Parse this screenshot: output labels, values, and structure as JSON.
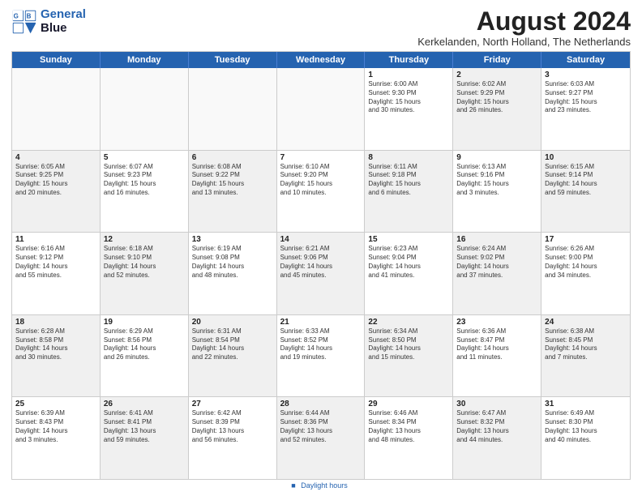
{
  "logo": {
    "line1": "General",
    "line2": "Blue"
  },
  "title": "August 2024",
  "location": "Kerkelanden, North Holland, The Netherlands",
  "days_of_week": [
    "Sunday",
    "Monday",
    "Tuesday",
    "Wednesday",
    "Thursday",
    "Friday",
    "Saturday"
  ],
  "footer": "Daylight hours",
  "weeks": [
    [
      {
        "day": "",
        "text": "",
        "empty": true
      },
      {
        "day": "",
        "text": "",
        "empty": true
      },
      {
        "day": "",
        "text": "",
        "empty": true
      },
      {
        "day": "",
        "text": "",
        "empty": true
      },
      {
        "day": "1",
        "text": "Sunrise: 6:00 AM\nSunset: 9:30 PM\nDaylight: 15 hours\nand 30 minutes.",
        "shaded": false
      },
      {
        "day": "2",
        "text": "Sunrise: 6:02 AM\nSunset: 9:29 PM\nDaylight: 15 hours\nand 26 minutes.",
        "shaded": true
      },
      {
        "day": "3",
        "text": "Sunrise: 6:03 AM\nSunset: 9:27 PM\nDaylight: 15 hours\nand 23 minutes.",
        "shaded": false
      }
    ],
    [
      {
        "day": "4",
        "text": "Sunrise: 6:05 AM\nSunset: 9:25 PM\nDaylight: 15 hours\nand 20 minutes.",
        "shaded": true
      },
      {
        "day": "5",
        "text": "Sunrise: 6:07 AM\nSunset: 9:23 PM\nDaylight: 15 hours\nand 16 minutes.",
        "shaded": false
      },
      {
        "day": "6",
        "text": "Sunrise: 6:08 AM\nSunset: 9:22 PM\nDaylight: 15 hours\nand 13 minutes.",
        "shaded": true
      },
      {
        "day": "7",
        "text": "Sunrise: 6:10 AM\nSunset: 9:20 PM\nDaylight: 15 hours\nand 10 minutes.",
        "shaded": false
      },
      {
        "day": "8",
        "text": "Sunrise: 6:11 AM\nSunset: 9:18 PM\nDaylight: 15 hours\nand 6 minutes.",
        "shaded": true
      },
      {
        "day": "9",
        "text": "Sunrise: 6:13 AM\nSunset: 9:16 PM\nDaylight: 15 hours\nand 3 minutes.",
        "shaded": false
      },
      {
        "day": "10",
        "text": "Sunrise: 6:15 AM\nSunset: 9:14 PM\nDaylight: 14 hours\nand 59 minutes.",
        "shaded": true
      }
    ],
    [
      {
        "day": "11",
        "text": "Sunrise: 6:16 AM\nSunset: 9:12 PM\nDaylight: 14 hours\nand 55 minutes.",
        "shaded": false
      },
      {
        "day": "12",
        "text": "Sunrise: 6:18 AM\nSunset: 9:10 PM\nDaylight: 14 hours\nand 52 minutes.",
        "shaded": true
      },
      {
        "day": "13",
        "text": "Sunrise: 6:19 AM\nSunset: 9:08 PM\nDaylight: 14 hours\nand 48 minutes.",
        "shaded": false
      },
      {
        "day": "14",
        "text": "Sunrise: 6:21 AM\nSunset: 9:06 PM\nDaylight: 14 hours\nand 45 minutes.",
        "shaded": true
      },
      {
        "day": "15",
        "text": "Sunrise: 6:23 AM\nSunset: 9:04 PM\nDaylight: 14 hours\nand 41 minutes.",
        "shaded": false
      },
      {
        "day": "16",
        "text": "Sunrise: 6:24 AM\nSunset: 9:02 PM\nDaylight: 14 hours\nand 37 minutes.",
        "shaded": true
      },
      {
        "day": "17",
        "text": "Sunrise: 6:26 AM\nSunset: 9:00 PM\nDaylight: 14 hours\nand 34 minutes.",
        "shaded": false
      }
    ],
    [
      {
        "day": "18",
        "text": "Sunrise: 6:28 AM\nSunset: 8:58 PM\nDaylight: 14 hours\nand 30 minutes.",
        "shaded": true
      },
      {
        "day": "19",
        "text": "Sunrise: 6:29 AM\nSunset: 8:56 PM\nDaylight: 14 hours\nand 26 minutes.",
        "shaded": false
      },
      {
        "day": "20",
        "text": "Sunrise: 6:31 AM\nSunset: 8:54 PM\nDaylight: 14 hours\nand 22 minutes.",
        "shaded": true
      },
      {
        "day": "21",
        "text": "Sunrise: 6:33 AM\nSunset: 8:52 PM\nDaylight: 14 hours\nand 19 minutes.",
        "shaded": false
      },
      {
        "day": "22",
        "text": "Sunrise: 6:34 AM\nSunset: 8:50 PM\nDaylight: 14 hours\nand 15 minutes.",
        "shaded": true
      },
      {
        "day": "23",
        "text": "Sunrise: 6:36 AM\nSunset: 8:47 PM\nDaylight: 14 hours\nand 11 minutes.",
        "shaded": false
      },
      {
        "day": "24",
        "text": "Sunrise: 6:38 AM\nSunset: 8:45 PM\nDaylight: 14 hours\nand 7 minutes.",
        "shaded": true
      }
    ],
    [
      {
        "day": "25",
        "text": "Sunrise: 6:39 AM\nSunset: 8:43 PM\nDaylight: 14 hours\nand 3 minutes.",
        "shaded": false
      },
      {
        "day": "26",
        "text": "Sunrise: 6:41 AM\nSunset: 8:41 PM\nDaylight: 13 hours\nand 59 minutes.",
        "shaded": true
      },
      {
        "day": "27",
        "text": "Sunrise: 6:42 AM\nSunset: 8:39 PM\nDaylight: 13 hours\nand 56 minutes.",
        "shaded": false
      },
      {
        "day": "28",
        "text": "Sunrise: 6:44 AM\nSunset: 8:36 PM\nDaylight: 13 hours\nand 52 minutes.",
        "shaded": true
      },
      {
        "day": "29",
        "text": "Sunrise: 6:46 AM\nSunset: 8:34 PM\nDaylight: 13 hours\nand 48 minutes.",
        "shaded": false
      },
      {
        "day": "30",
        "text": "Sunrise: 6:47 AM\nSunset: 8:32 PM\nDaylight: 13 hours\nand 44 minutes.",
        "shaded": true
      },
      {
        "day": "31",
        "text": "Sunrise: 6:49 AM\nSunset: 8:30 PM\nDaylight: 13 hours\nand 40 minutes.",
        "shaded": false
      }
    ]
  ]
}
